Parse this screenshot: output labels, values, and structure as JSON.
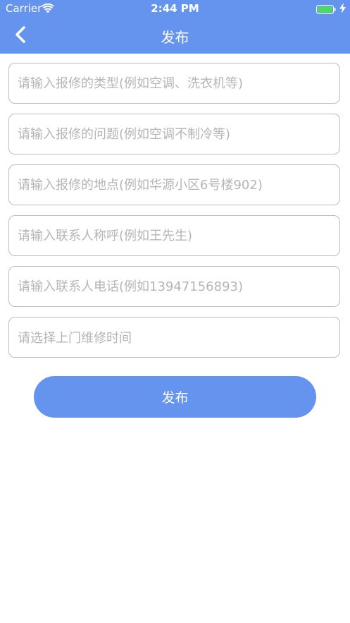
{
  "status_bar": {
    "carrier": "Carrier",
    "time": "2:44 PM",
    "wifi_icon": "wifi-icon",
    "battery_icon": "battery-icon",
    "charge_icon": "charging-bolt-icon"
  },
  "nav": {
    "title": "发布",
    "back_icon": "chevron-left-icon"
  },
  "form": {
    "repair_type_placeholder": "请输入报修的类型(例如空调、洗衣机等)",
    "repair_issue_placeholder": "请输入报修的问题(例如空调不制冷等)",
    "repair_location_placeholder": "请输入报修的地点(例如华源小区6号楼902)",
    "contact_name_placeholder": "请输入联系人称呼(例如王先生)",
    "contact_phone_placeholder": "请输入联系人电话(例如13947156893)",
    "visit_time_label": "请选择上门维修时间",
    "submit_label": "发布"
  },
  "colors": {
    "primary": "#6494EE",
    "border": "#BDBDBD",
    "placeholder": "#B5B5B5",
    "background": "#FFFFFF",
    "battery": "#4CD964"
  }
}
